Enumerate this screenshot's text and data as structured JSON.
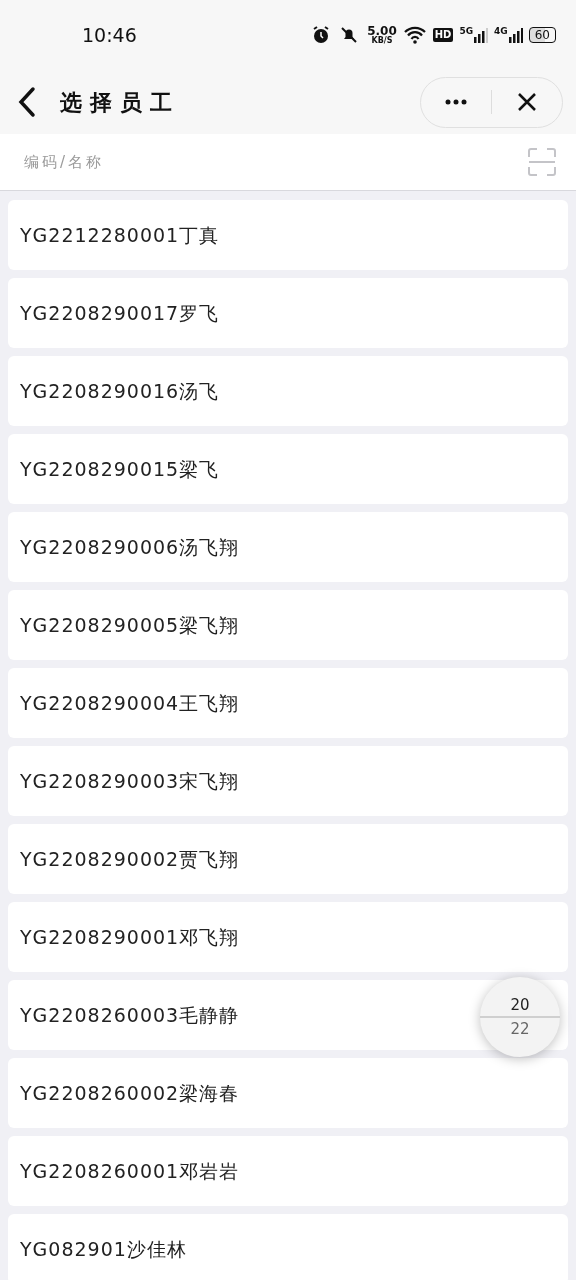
{
  "status_bar": {
    "time": "10:46",
    "speed": "5.00",
    "speed_unit": "KB/S",
    "hd": "HD",
    "network_1": "5G",
    "network_2": "4G",
    "battery": "60"
  },
  "nav": {
    "title": "选择员工"
  },
  "search": {
    "placeholder": "编码/名称"
  },
  "employees": [
    {
      "label": "YG2212280001丁真"
    },
    {
      "label": "YG2208290017罗飞"
    },
    {
      "label": "YG2208290016汤飞"
    },
    {
      "label": "YG2208290015梁飞"
    },
    {
      "label": "YG2208290006汤飞翔"
    },
    {
      "label": "YG2208290005梁飞翔"
    },
    {
      "label": "YG2208290004王飞翔"
    },
    {
      "label": "YG2208290003宋飞翔"
    },
    {
      "label": "YG2208290002贾飞翔"
    },
    {
      "label": "YG2208290001邓飞翔"
    },
    {
      "label": "YG2208260003毛静静"
    },
    {
      "label": "YG2208260002梁海春"
    },
    {
      "label": "YG2208260001邓岩岩"
    },
    {
      "label": "YG082901沙佳林"
    }
  ],
  "page_counter": {
    "current": "20",
    "total": "22"
  }
}
